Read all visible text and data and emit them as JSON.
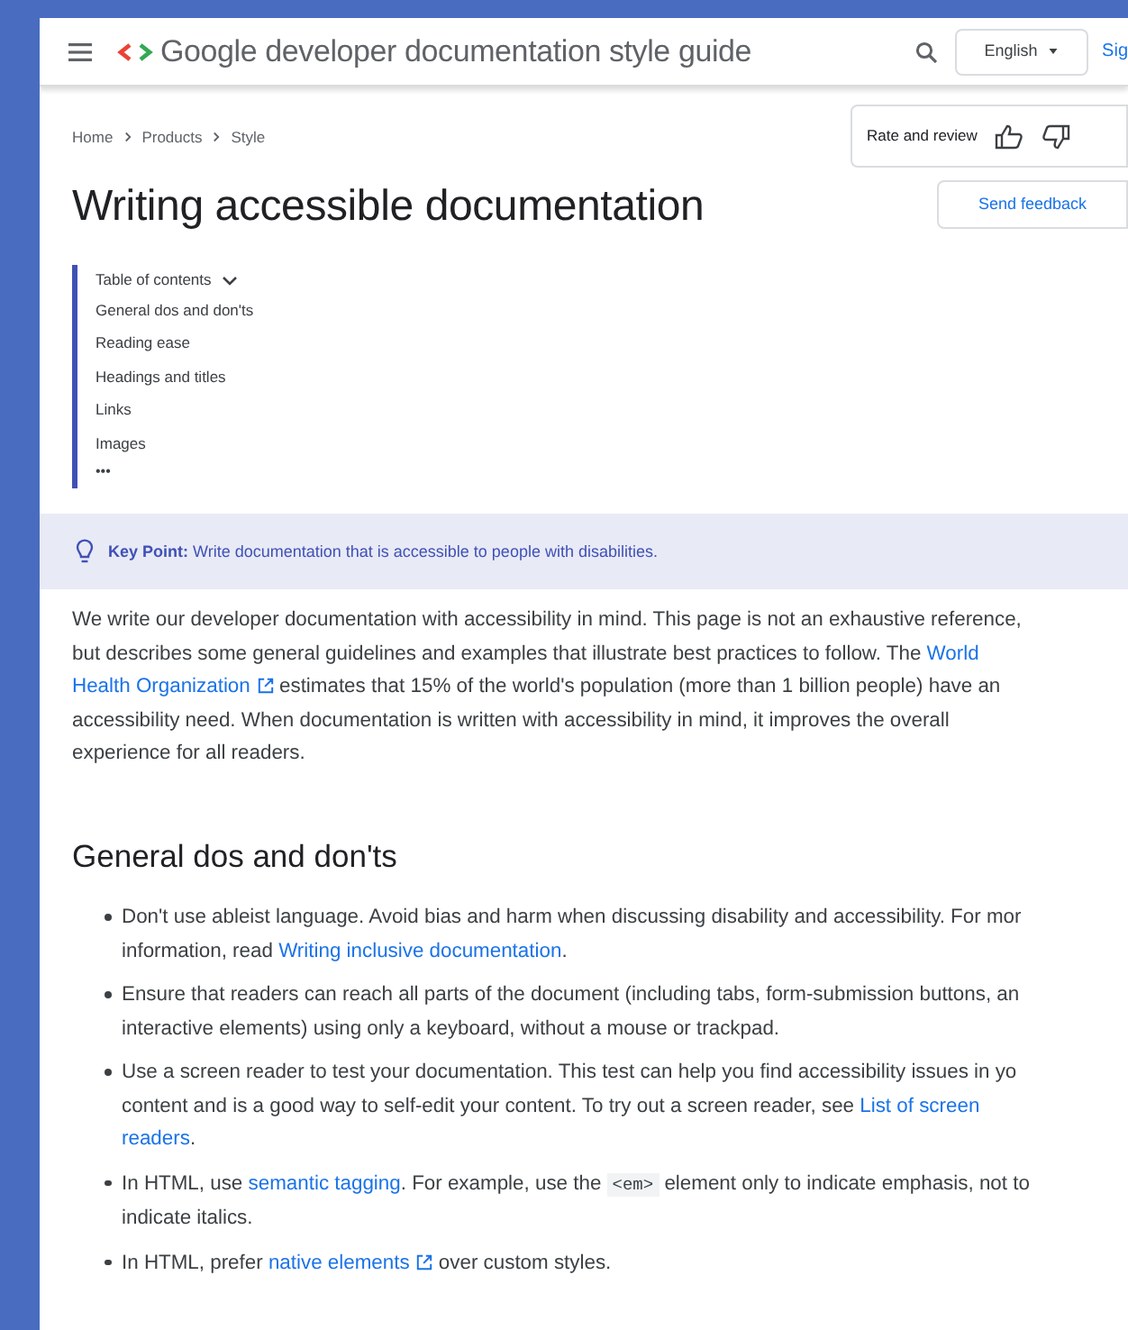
{
  "header": {
    "site_title": "Google developer documentation style guide",
    "language": "English",
    "sign_in": "Sig"
  },
  "breadcrumbs": [
    "Home",
    "Products",
    "Style"
  ],
  "rate_and_review": "Rate and review",
  "title": "Writing accessible documentation",
  "send_feedback": "Send feedback",
  "toc": {
    "heading": "Table of contents",
    "expanded": true,
    "items": [
      "General dos and don'ts",
      "Reading ease",
      "Headings and titles",
      "Links",
      "Images"
    ],
    "more": "•••"
  },
  "key_point": {
    "label": "Key Point:",
    "text": "Write documentation that is accessible to people with disabilities."
  },
  "intro": {
    "lines": [
      [
        {
          "text": "We write our developer documentation with accessibility in mind. This page is not an exhaustive reference,"
        }
      ],
      [
        {
          "text": "but describes some general guidelines and examples that illustrate best practices to follow. The "
        },
        {
          "text": "World",
          "kind": "link"
        }
      ],
      [
        {
          "text": "Health Organization",
          "kind": "external"
        },
        {
          "text": " estimates that 15% of the world's population (more than 1 billion people) have an"
        }
      ],
      [
        {
          "text": "accessibility need. When documentation is written with accessibility in mind, it improves the overall"
        }
      ],
      [
        {
          "text": "experience for all readers."
        }
      ]
    ]
  },
  "section_heading": "General dos and don'ts",
  "bullets": [
    {
      "lines": [
        [
          {
            "text": "Don't use ableist language. Avoid bias and harm when discussing disability and accessibility. For mor"
          }
        ],
        [
          {
            "text": "information, read "
          },
          {
            "text": "Writing inclusive documentation",
            "kind": "link"
          },
          {
            "text": "."
          }
        ]
      ]
    },
    {
      "lines": [
        [
          {
            "text": "Ensure that readers can reach all parts of the document (including tabs, form-submission buttons, an"
          }
        ],
        [
          {
            "text": "interactive elements) using only a keyboard, without a mouse or trackpad."
          }
        ]
      ]
    },
    {
      "lines": [
        [
          {
            "text": "Use a screen reader to test your documentation. This test can help you find accessibility issues in yo"
          }
        ],
        [
          {
            "text": "content and is a good way to self-edit your content. To try out a screen reader, see "
          },
          {
            "text": "List of screen",
            "kind": "link"
          }
        ],
        [
          {
            "text": "readers",
            "kind": "link"
          },
          {
            "text": "."
          }
        ]
      ]
    },
    {
      "lines": [
        [
          {
            "text": "In HTML, use "
          },
          {
            "text": "semantic tagging",
            "kind": "link"
          },
          {
            "text": ". For example, use the "
          },
          {
            "text": "<em>",
            "kind": "code"
          },
          {
            "text": " element only to indicate emphasis, not to"
          }
        ],
        [
          {
            "text": "indicate italics."
          }
        ]
      ]
    },
    {
      "lines": [
        [
          {
            "text": "In HTML, prefer "
          },
          {
            "text": "native elements",
            "kind": "external"
          },
          {
            "text": " over custom styles."
          }
        ]
      ]
    }
  ]
}
